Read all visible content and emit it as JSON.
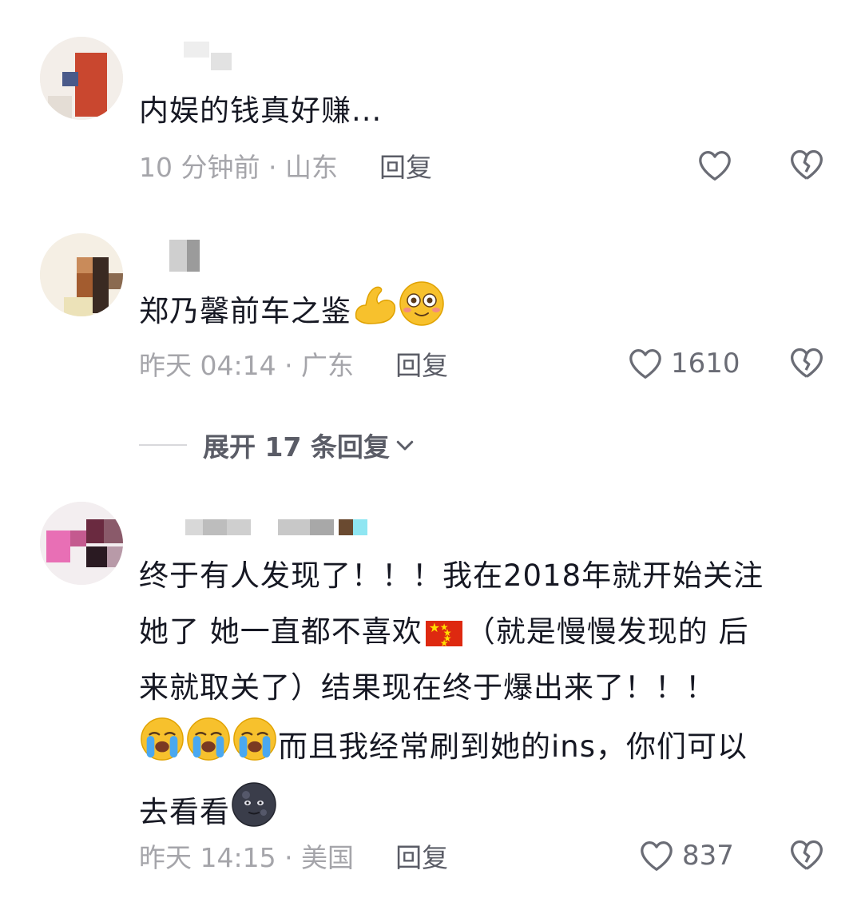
{
  "comments": [
    {
      "text": "内娱的钱真好赚...",
      "time": "10 分钟前 · 山东",
      "reply_label": "回复",
      "likes": ""
    },
    {
      "text": "郑乃馨前车之鉴",
      "time": "昨天 04:14 · 广东",
      "reply_label": "回复",
      "likes": "1610",
      "expand_label": "展开 17 条回复"
    },
    {
      "lines": [
        "终于有人发现了！！！我在2018年就开始关注",
        "她了 她一直都不喜欢",
        "（就是慢慢发现的 后",
        "来就取关了）结果现在终于爆出来了！！！",
        "而且我经常刷到她的ins，你们可以",
        "去看看"
      ],
      "time": "昨天 14:15 · 美国",
      "reply_label": "回复",
      "likes": "837"
    }
  ],
  "colors": {
    "text": "#161823",
    "meta": "#a5a5aa",
    "reply": "#5a5c66",
    "icon": "#6a6c75"
  },
  "icons": [
    "heart-outline-icon",
    "broken-heart-icon",
    "chevron-down-icon",
    "flexed-biceps-emoji",
    "flushed-face-emoji",
    "china-flag-emoji",
    "loudly-crying-face-emoji",
    "new-moon-face-emoji"
  ]
}
